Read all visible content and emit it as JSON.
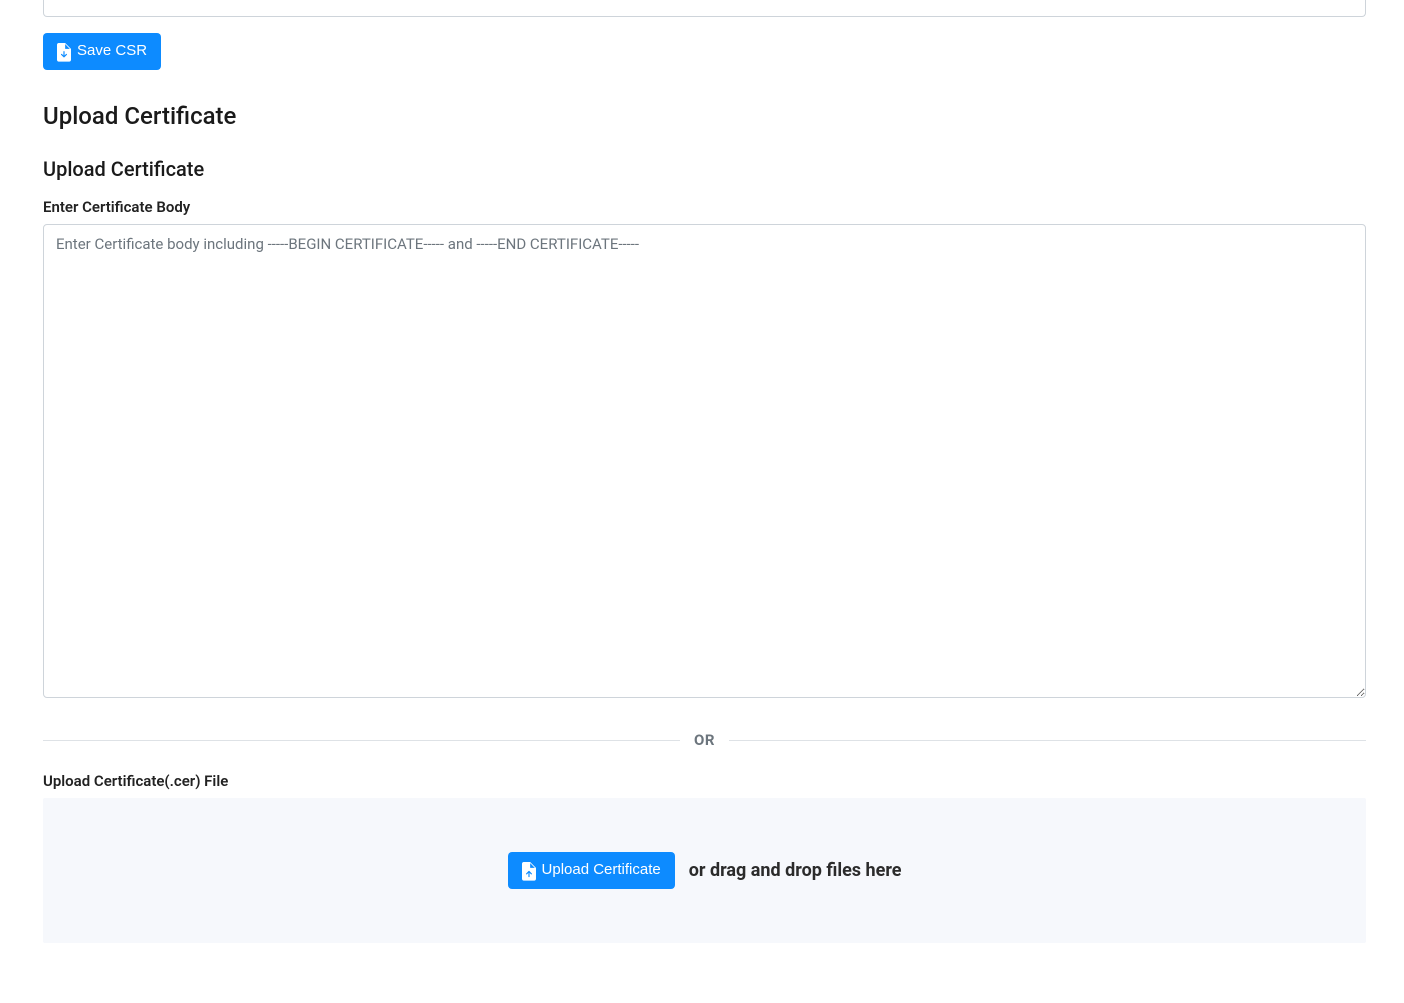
{
  "topInput": {
    "value": ""
  },
  "saveCsr": {
    "label": "Save CSR"
  },
  "section": {
    "title": "Upload Certificate",
    "subTitle": "Upload Certificate",
    "bodyLabel": "Enter Certificate Body",
    "bodyPlaceholder": "Enter Certificate body including -----BEGIN CERTIFICATE----- and -----END CERTIFICATE-----",
    "dividerWord": "OR",
    "fileLabel": "Upload Certificate(.cer) File",
    "uploadBtn": "Upload Certificate",
    "dragHint": "or drag and drop files here"
  }
}
